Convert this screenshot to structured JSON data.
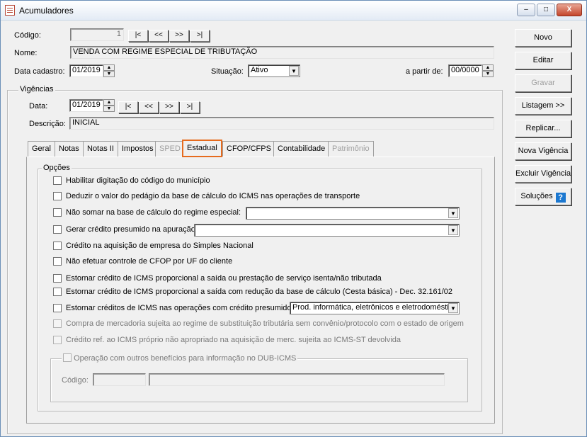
{
  "window": {
    "title": "Acumuladores",
    "controls": {
      "minimize": "–",
      "maximize": "□",
      "close": "X"
    }
  },
  "header": {
    "codigo_label": "Código:",
    "codigo_value": "1",
    "nav": [
      "|<",
      "<<",
      ">>",
      ">|"
    ],
    "nome_label": "Nome:",
    "nome_value": "VENDA COM REGIME ESPECIAL DE TRIBUTAÇÃO",
    "data_cadastro_label": "Data cadastro:",
    "data_cadastro_value": "01/2019",
    "situacao_label": "Situação:",
    "situacao_value": "Ativo",
    "a_partir_label": "a partir de:",
    "a_partir_value": "00/0000"
  },
  "vigencias": {
    "title": "Vigências",
    "data_label": "Data:",
    "data_value": "01/2019",
    "nav": [
      "|<",
      "<<",
      ">>",
      ">|"
    ],
    "descricao_label": "Descrição:",
    "descricao_value": "INICIAL"
  },
  "tabs": [
    {
      "label": "Geral",
      "state": "normal"
    },
    {
      "label": "Notas",
      "state": "normal"
    },
    {
      "label": "Notas II",
      "state": "normal"
    },
    {
      "label": "Impostos",
      "state": "normal"
    },
    {
      "label": "SPED",
      "state": "disabled"
    },
    {
      "label": "Estadual",
      "state": "active"
    },
    {
      "label": "CFOP/CFPS",
      "state": "normal"
    },
    {
      "label": "Contabilidade",
      "state": "normal"
    },
    {
      "label": "Patrimônio",
      "state": "disabled"
    }
  ],
  "opcoes": {
    "title": "Opções",
    "items": [
      {
        "label": "Habilitar digitação do código do município",
        "checked": false,
        "enabled": true
      },
      {
        "label": "Deduzir o valor do pedágio da base de cálculo do ICMS nas operações de transporte",
        "checked": false,
        "enabled": true
      },
      {
        "label": "Não somar na base de cálculo do regime especial:",
        "checked": false,
        "enabled": true,
        "select": ""
      },
      {
        "label": "Gerar crédito presumido na apuração",
        "checked": false,
        "enabled": true,
        "select": ""
      },
      {
        "label": "Crédito na aquisição de empresa do Simples Nacional",
        "checked": false,
        "enabled": true
      },
      {
        "label": "Não efetuar controle de CFOP por UF do cliente",
        "checked": false,
        "enabled": true
      },
      {
        "label": "Estornar crédito de ICMS proporcional a saída ou prestação de serviço isenta/não tributada",
        "checked": false,
        "enabled": true
      },
      {
        "label": "Estornar crédito de ICMS proporcional a saída com redução da base de cálculo (Cesta básica) - Dec. 32.161/02",
        "checked": false,
        "enabled": true
      },
      {
        "label": "Estornar créditos de ICMS nas operações com crédito presumido",
        "checked": false,
        "enabled": true,
        "select": "Prod. informática, eletrônicos e eletrodoméstic"
      },
      {
        "label": "Compra de mercadoria sujeita ao regime de substituição tributária sem convênio/protocolo com o estado de origem",
        "checked": false,
        "enabled": false
      },
      {
        "label": "Crédito ref. ao ICMS próprio não apropriado na aquisição de merc. sujeita ao ICMS-ST devolvida",
        "checked": false,
        "enabled": false
      }
    ],
    "dub": {
      "label": "Operação com outros benefícios para informação no DUB-ICMS",
      "checked": false,
      "codigo_label": "Código:",
      "codigo_value": "",
      "descricao_value": ""
    }
  },
  "side_buttons": [
    {
      "label": "Novo",
      "enabled": true
    },
    {
      "label": "Editar",
      "enabled": true
    },
    {
      "label": "Gravar",
      "enabled": false
    },
    {
      "label": "Listagem >>",
      "enabled": true
    },
    {
      "label": "Replicar...",
      "enabled": true
    },
    {
      "label": "Nova Vigência",
      "enabled": true
    },
    {
      "label": "Excluir Vigência",
      "enabled": true
    },
    {
      "label": "Soluções",
      "enabled": true,
      "icon": "help-icon"
    }
  ],
  "colors": {
    "active_tab_border": "#e66b1e",
    "help_icon": "#1c78d0"
  }
}
